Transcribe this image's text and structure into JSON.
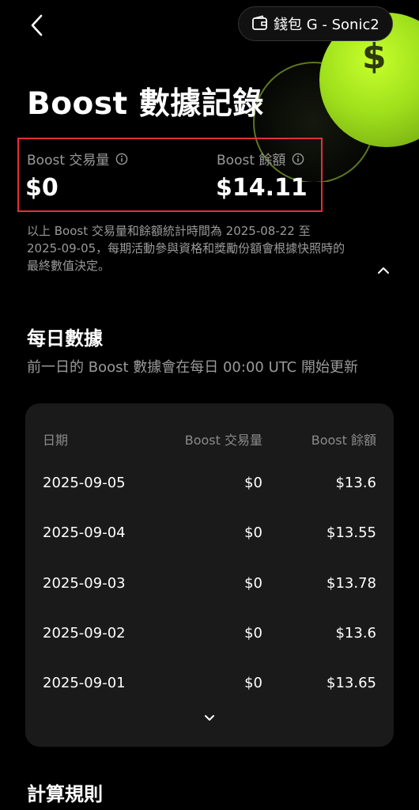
{
  "header": {
    "wallet_label": "錢包 G - Sonic2"
  },
  "coin": {
    "symbol": "$",
    "color": "#a8e61f"
  },
  "title": "Boost 數據記錄",
  "stats": {
    "volume_label": "Boost 交易量",
    "volume_value": "$0",
    "balance_label": "Boost 餘額",
    "balance_value": "$14.11",
    "highlight_color": "#e0313a"
  },
  "note": {
    "line1": "以上 Boost 交易量和餘額統計時間為 2025-08-22 至",
    "line2": "2025-09-05，每期活動參與資格和獎勵份額會根據快照時的",
    "line3": "最終數值決定。"
  },
  "daily": {
    "title": "每日數據",
    "subtitle": "前一日的 Boost 數據會在每日 00:00 UTC 開始更新",
    "columns": [
      "日期",
      "Boost 交易量",
      "Boost 餘額"
    ],
    "rows": [
      {
        "date": "2025-09-05",
        "volume": "$0",
        "balance": "$13.6"
      },
      {
        "date": "2025-09-04",
        "volume": "$0",
        "balance": "$13.55"
      },
      {
        "date": "2025-09-03",
        "volume": "$0",
        "balance": "$13.78"
      },
      {
        "date": "2025-09-02",
        "volume": "$0",
        "balance": "$13.6"
      },
      {
        "date": "2025-09-01",
        "volume": "$0",
        "balance": "$13.65"
      }
    ]
  },
  "rules": {
    "title": "計算規則"
  }
}
